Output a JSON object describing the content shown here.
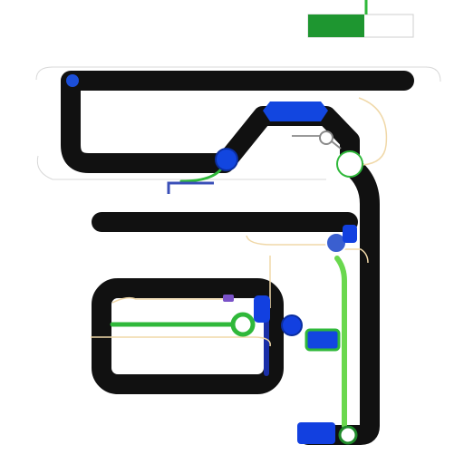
{
  "colors": {
    "track": "#111111",
    "accent_blue": "#1240e0",
    "accent_green": "#36c03a",
    "dark_green": "#1f8a2a",
    "thin_line": "#f0d8a8",
    "gray_line": "#d0d0d0"
  },
  "header": {
    "caption_line1": "",
    "caption_line2": ""
  },
  "top_right_card": {
    "left_label": "",
    "right_label": ""
  },
  "top_bar": {
    "left_label": "",
    "center_label": ""
  },
  "middle_bar": {
    "left_label": "",
    "center_label": ""
  },
  "loop_box": {
    "top_label": "",
    "bottom_label": "",
    "left_side_label": ""
  },
  "right_side_label": "",
  "bottom_badge_label": "",
  "icons": {
    "node_top_left": "blue-dot-icon",
    "node_diagonal": "blue-node-icon",
    "node_right_ring": "white-ring-icon",
    "node_mid_right": "blue-node-icon",
    "node_box_green": "green-ring-icon",
    "node_box_blue": "blue-dot-icon",
    "connector_key": "key-connector-icon"
  }
}
